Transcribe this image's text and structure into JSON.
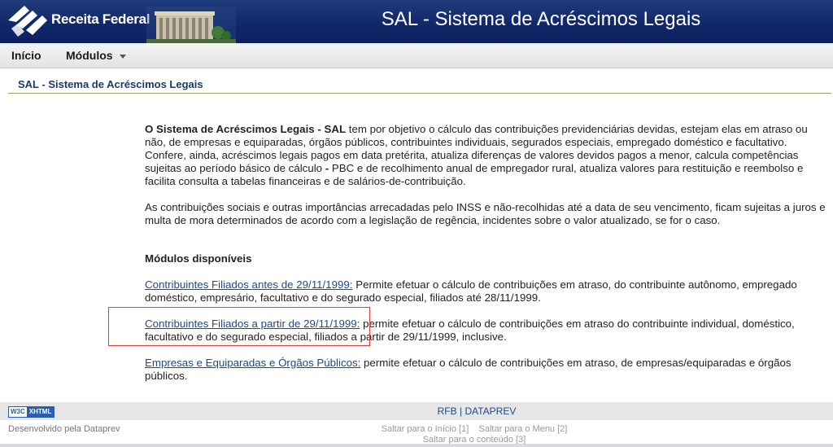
{
  "header": {
    "logo_text": "Receita Federal",
    "app_title": "SAL - Sistema de Acréscimos Legais",
    "brand_color": "#11286a"
  },
  "menu": {
    "items": [
      {
        "label": "Início"
      },
      {
        "label": "Módulos"
      }
    ]
  },
  "page": {
    "heading": "SAL - Sistema de Acréscimos Legais",
    "intro_bold": "O Sistema de Acréscimos Legais - SAL",
    "intro_rest_1": " tem por objetivo o cálculo das contribuições previdenciárias devidas, estejam elas em atraso ou não, de empresas e equiparadas, órgãos públicos, contribuintes individuais, segurados especiais, empregado doméstico e facultativo. Confere, ainda, acréscimos legais pagos em data pretérita, atualiza diferenças de valores devidos pagos a menor, calcula competências sujeitas ao período básico de cálculo ",
    "intro_pbc_bold": "- ",
    "intro_rest_2": "PBC e de recolhimento anual de empregador rural, atualiza valores para restituição e reembolso e facilita consulta a tabelas financeiras e de salários-de-contribuição.",
    "paragraph_2": "As contribuições sociais e outras importâncias arrecadadas pelo INSS e não-recolhidas até a data de seu vencimento, ficam sujeitas a juros e multa de mora determinados de acordo com a legislação de regência, incidentes sobre o valor atualizado, se for o caso.",
    "modules_title": "Módulos disponíveis",
    "modules": [
      {
        "link": "Contribuintes Filiados antes de 29/11/1999:",
        "text": " Permite efetuar o cálculo de contribuições em atraso, do contribuinte autônomo, empregado doméstico, empresário, facultativo e do segurado especial, filiados até 28/11/1999."
      },
      {
        "link": "Contribuintes Filiados a partir de 29/11/1999:",
        "text": " permite efetuar o cálculo de contribuições em atraso do contribuinte individual, doméstico, facultativo e do segurado especial, filiados a partir de 29/11/1999, inclusive."
      },
      {
        "link": "Empresas e Equiparadas e Órgãos Públicos:",
        "text": " permite efetuar o cálculo de contribuições em atraso, de empresas/equiparadas e órgãos públicos."
      }
    ]
  },
  "footer": {
    "badge_w3c": "W3C",
    "badge_xhtml": "XHTML",
    "link_rfb": "RFB",
    "separator": " | ",
    "link_dataprev": "DATAPREV",
    "dev_credit": "Desenvolvido pela Dataprev",
    "skip_inicio": "Saltar para o Início [1]",
    "skip_menu": "Saltar para o Menu [2]",
    "skip_conteudo": "Saltar para o conteúdo [3]"
  }
}
